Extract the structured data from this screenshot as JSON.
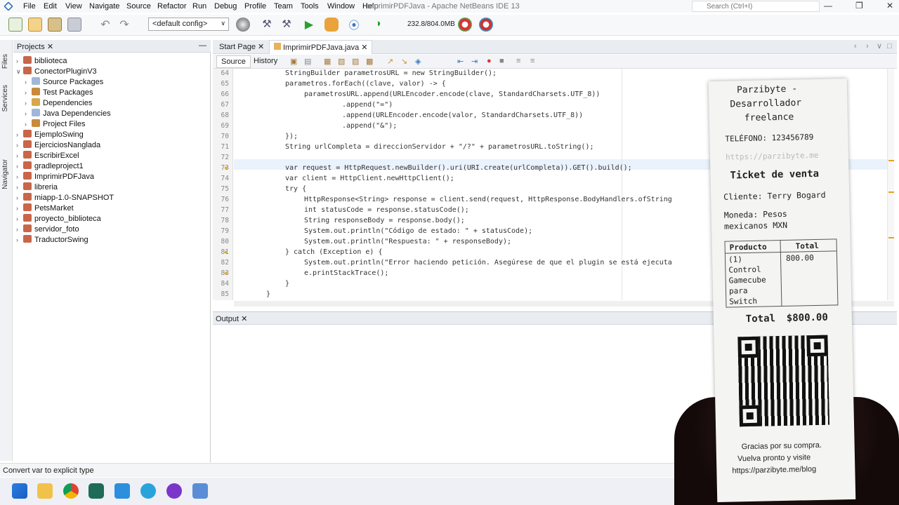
{
  "window": {
    "title": "ImprimirPDFJava - Apache NetBeans IDE 13",
    "menu": [
      "File",
      "Edit",
      "View",
      "Navigate",
      "Source",
      "Refactor",
      "Run",
      "Debug",
      "Profile",
      "Team",
      "Tools",
      "Window",
      "Help"
    ],
    "search_placeholder": "Search (Ctrl+I)"
  },
  "toolbar": {
    "config": "<default config>",
    "memory": "232.8/804.0MB"
  },
  "side_strip": [
    "Files",
    "Services",
    "Navigator"
  ],
  "projects_panel": {
    "tab_label": "Projects",
    "tree": [
      {
        "label": "biblioteca",
        "level": 0,
        "expanded": false
      },
      {
        "label": "ConectorPluginV3",
        "level": 0,
        "expanded": true
      },
      {
        "label": "Source Packages",
        "level": 1,
        "expanded": false
      },
      {
        "label": "Test Packages",
        "level": 1,
        "expanded": false
      },
      {
        "label": "Dependencies",
        "level": 1,
        "expanded": false
      },
      {
        "label": "Java Dependencies",
        "level": 1,
        "expanded": false
      },
      {
        "label": "Project Files",
        "level": 1,
        "expanded": false
      },
      {
        "label": "EjemploSwing",
        "level": 0,
        "expanded": false
      },
      {
        "label": "EjerciciosNanglada",
        "level": 0,
        "expanded": false
      },
      {
        "label": "EscribirExcel",
        "level": 0,
        "expanded": false
      },
      {
        "label": "gradleproject1",
        "level": 0,
        "expanded": false
      },
      {
        "label": "ImprimirPDFJava",
        "level": 0,
        "expanded": false
      },
      {
        "label": "libreria",
        "level": 0,
        "expanded": false
      },
      {
        "label": "miapp-1.0-SNAPSHOT",
        "level": 0,
        "expanded": false
      },
      {
        "label": "PetsMarket",
        "level": 0,
        "expanded": false
      },
      {
        "label": "proyecto_biblioteca",
        "level": 0,
        "expanded": false
      },
      {
        "label": "servidor_foto",
        "level": 0,
        "expanded": false
      },
      {
        "label": "TraductorSwing",
        "level": 0,
        "expanded": false
      }
    ]
  },
  "editor": {
    "tabs": [
      "Start Page",
      "ImprimirPDFJava.java"
    ],
    "active_tab": 1,
    "view_tabs": [
      "Source",
      "History"
    ],
    "lines": [
      {
        "n": "64",
        "code": "StringBuilder parametrosURL = new StringBuilder();",
        "indent": 0
      },
      {
        "n": "65",
        "code": "parametros.forEach((clave, valor) -> {",
        "indent": 0
      },
      {
        "n": "66",
        "code": "parametrosURL.append(URLEncoder.encode(clave, StandardCharsets.UTF_8))",
        "indent": 1
      },
      {
        "n": "67",
        "code": ".append(\"=\")",
        "indent": 3
      },
      {
        "n": "68",
        "code": ".append(URLEncoder.encode(valor, StandardCharsets.UTF_8))",
        "indent": 3
      },
      {
        "n": "69",
        "code": ".append(\"&\");",
        "indent": 3
      },
      {
        "n": "70",
        "code": "});",
        "indent": 0
      },
      {
        "n": "71",
        "code": "String urlCompleta = direccionServidor + \"/?\" + parametrosURL.toString();",
        "indent": 0
      },
      {
        "n": "72",
        "code": "",
        "indent": 0
      },
      {
        "n": "73",
        "code": "var request = HttpRequest.newBuilder().uri(URI.create(urlCompleta)).GET().build();",
        "indent": 0
      },
      {
        "n": "74",
        "code": "var client = HttpClient.newHttpClient();",
        "indent": 0
      },
      {
        "n": "75",
        "code": "try {",
        "indent": 0
      },
      {
        "n": "76",
        "code": "HttpResponse<String> response = client.send(request, HttpResponse.BodyHandlers.ofString",
        "indent": 1
      },
      {
        "n": "77",
        "code": "int statusCode = response.statusCode();",
        "indent": 1
      },
      {
        "n": "78",
        "code": "String responseBody = response.body();",
        "indent": 1
      },
      {
        "n": "79",
        "code": "System.out.println(\"Código de estado: \" + statusCode);",
        "indent": 1
      },
      {
        "n": "80",
        "code": "System.out.println(\"Respuesta: \" + responseBody);",
        "indent": 1
      },
      {
        "n": "81",
        "code": "} catch (Exception e) {",
        "indent": 0
      },
      {
        "n": "82",
        "code": "System.out.println(\"Error haciendo petición. Asegúrese de que el plugin se está ejecuta",
        "indent": 1
      },
      {
        "n": "83",
        "code": "e.printStackTrace();",
        "indent": 1
      },
      {
        "n": "84",
        "code": "}",
        "indent": 0
      },
      {
        "n": "85",
        "code": "}",
        "indent": -1
      }
    ]
  },
  "output_panel": {
    "tab_label": "Output"
  },
  "status": {
    "text": "Convert var to explicit type"
  },
  "receipt": {
    "business": [
      "Parzibyte -",
      "Desarrollador",
      "freelance"
    ],
    "phone": "TELÉFONO: 123456789",
    "url_faded": "https://parzibyte.me",
    "heading": "Ticket de venta",
    "client": "Cliente: Terry Bogard",
    "currency": [
      "Moneda: Pesos",
      "mexicanos MXN"
    ],
    "table_headers": [
      "Producto",
      "Total"
    ],
    "item_lines": [
      "(1)",
      "Control",
      "Gamecube",
      "para",
      "Switch"
    ],
    "item_total": "800.00",
    "total_label": "Total",
    "total_value": "$800.00",
    "footer": [
      "Gracias por su compra.",
      "Vuelva pronto y visite",
      "https://parzibyte.me/blog"
    ]
  },
  "colors": {
    "accent": "#2f6db5",
    "keyword": "#0000e6",
    "string": "#ce7b00",
    "highlight": "#eaf2fc"
  }
}
